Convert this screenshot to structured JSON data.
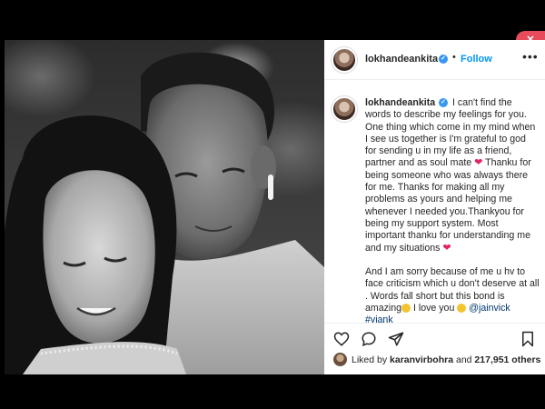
{
  "post": {
    "username": "lokhandeankita",
    "verified_glyph": "✓",
    "dot": "•",
    "follow_label": "Follow",
    "more_label": "•••",
    "caption_part1": " I can't find the words to describe my feelings for you. One thing which come in my mind when I see us together is I'm grateful to god for sending u in my life as a friend, partner and as soul mate ",
    "caption_part2": " Thanku for being someone who was always there for me. Thanks for making all my problems as yours and helping me whenever I needed you.Thankyou for being my support system. Most important thanku for understanding me and my situations ",
    "caption_part3": "And I am sorry because of me u hv to face criticism which u don't deserve at all . Words fall short but this bond is amazing",
    "caption_part4": " I love you ",
    "mention": "@jainvick",
    "hashtag": "#viank",
    "heart_glyph": "❤",
    "likes_prefix": "Liked by ",
    "likes_user": "karanvirbohra",
    "likes_middle": " and ",
    "likes_count": "217,951 others"
  },
  "badge": {
    "label": "✕"
  },
  "icons": {
    "like": "heart-outline-icon",
    "comment": "comment-bubble-icon",
    "share": "paper-plane-icon",
    "save": "bookmark-icon"
  },
  "colors": {
    "link_blue": "#0095f6",
    "verified_blue": "#3897f0",
    "heart_red": "#e0245e",
    "badge_red": "#e74c5a"
  }
}
